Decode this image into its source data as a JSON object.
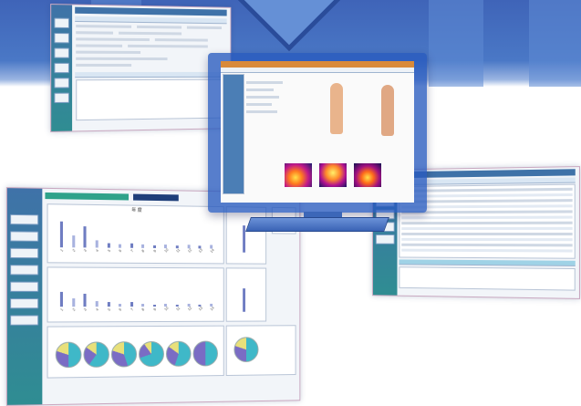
{
  "colors": {
    "background_band": "#4a78c6",
    "monitor_bezel": "#2d5fbf",
    "app_sidebar": "#3f72a8",
    "app_panel": "#f2f5f9",
    "bar_primary": "#6f7dc2",
    "pie_teal": "#3fb8c8",
    "pie_purple": "#7a6cc4",
    "pie_yellow": "#e8e07a"
  },
  "top_left_app": {
    "sidebar_buttons": [
      "",
      "",
      "",
      "",
      "",
      ""
    ]
  },
  "dashboard_app": {
    "sidebar_buttons": [
      "",
      "",
      "",
      "",
      "",
      "",
      ""
    ],
    "panels": [
      {
        "title": "年 度",
        "chart": "bar"
      },
      {
        "title": "",
        "chart": "bar"
      },
      {
        "title": "",
        "chart": "pie"
      }
    ]
  },
  "monitor_screen": {
    "icons": [
      "body-front-figure",
      "body-back-figure",
      "thermal-image"
    ]
  },
  "right_app": {
    "sidebar_buttons": [
      "",
      "",
      "",
      "",
      ""
    ]
  },
  "chart_data": [
    {
      "type": "bar",
      "title": "年 度",
      "categories": [
        "1",
        "2",
        "3",
        "4",
        "5",
        "6",
        "7",
        "8",
        "9",
        "10",
        "11",
        "12",
        "13",
        "14"
      ],
      "values": [
        22,
        10,
        18,
        6,
        4,
        3,
        4,
        3,
        2,
        3,
        2,
        3,
        2,
        3
      ],
      "ylim": [
        0,
        30
      ]
    },
    {
      "type": "bar",
      "title": "",
      "categories": [
        "1",
        "2",
        "3",
        "4",
        "5",
        "6",
        "7",
        "8",
        "9",
        "10",
        "11",
        "12",
        "13",
        "14"
      ],
      "values": [
        14,
        8,
        12,
        5,
        4,
        3,
        4,
        3,
        2,
        3,
        2,
        3,
        2,
        3
      ],
      "ylim": [
        0,
        30
      ]
    },
    {
      "type": "pie",
      "title": "",
      "pies": [
        {
          "slices": [
            50,
            30,
            20
          ]
        },
        {
          "slices": [
            60,
            25,
            15
          ]
        },
        {
          "slices": [
            45,
            35,
            20
          ]
        },
        {
          "slices": [
            70,
            20,
            10
          ]
        },
        {
          "slices": [
            55,
            30,
            15
          ]
        },
        {
          "slices": [
            50,
            50
          ]
        }
      ]
    }
  ]
}
